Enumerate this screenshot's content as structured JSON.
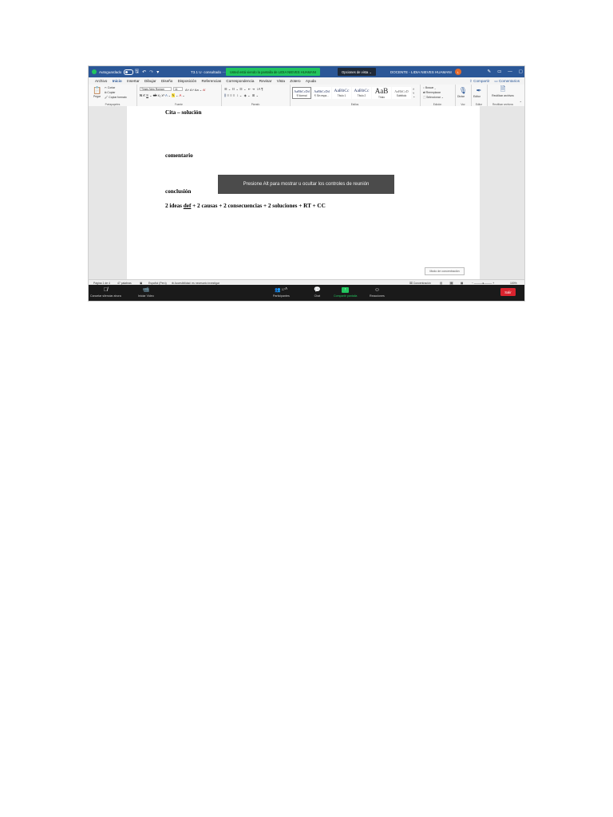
{
  "titlebar": {
    "autosave_label": "Autoguardado",
    "doc_title": "T3.1 U· consultado ···",
    "share_banner": "Usted está viendo la pantalla de LIDIA NIEVES HUAMANI",
    "view_options": "Opciones de vista ⌄",
    "account_name": "DOCENTE - LIDIA NIEVES HUAMANI",
    "account_initials": "L"
  },
  "menu": {
    "tabs": [
      "Archivo",
      "Inicio",
      "Insertar",
      "Dibujar",
      "Diseño",
      "Disposición",
      "Referencias",
      "Correspondencia",
      "Revisar",
      "Vista",
      "Zotero",
      "Ayuda"
    ],
    "active_tab": "Inicio",
    "share_label": "Compartir",
    "comments_label": "Comentarios"
  },
  "ribbon": {
    "clipboard": {
      "paste": "Pegar",
      "cut": "Cortar",
      "copy": "Copiar",
      "format_painter": "Copiar formato",
      "caption": "Portapapeles"
    },
    "font": {
      "name": "Times New Roman",
      "size": "11",
      "caption": "Fuente"
    },
    "paragraph": {
      "caption": "Párrafo"
    },
    "styles": {
      "items": [
        {
          "preview": "AaBbCcDd",
          "name": "¶ Normal"
        },
        {
          "preview": "AaBbCcDd",
          "name": "¶ Sin espa..."
        },
        {
          "preview": "AaBbCc",
          "name": "Título 1"
        },
        {
          "preview": "AaBbCc",
          "name": "Título 2"
        },
        {
          "preview": "AaB",
          "name": "Título"
        },
        {
          "preview": "AaBbCcD",
          "name": "Subtítulo"
        }
      ],
      "caption": "Estilos"
    },
    "editing": {
      "find": "Buscar",
      "replace": "Reemplazar",
      "select": "Seleccionar",
      "caption": "Edición"
    },
    "voice": {
      "dictate": "Dictar",
      "caption": "Voz"
    },
    "editor": {
      "label": "Editor",
      "caption": "Editor"
    },
    "sensitivity": {
      "label": "Reutilizar archivos",
      "caption": "Reutilizar archivos"
    }
  },
  "document": {
    "line1": "Cita – solución",
    "line2": "comentario",
    "line3": "conclusión",
    "line4_a": "2 ideas ",
    "line4_b": "def",
    "line4_c": " + 2 causas + 2 consecuencias + 2 soluciones + RT + CC"
  },
  "tooltip": "Presione Alt para mostrar u ocultar los controles de reunión",
  "conversation_mode": "Modo de concentración",
  "status": {
    "page": "Página 1 de 4",
    "words": "47 palabras",
    "language": "Español (Perú)",
    "accessibility": "Accesibilidad: es necesario investigar",
    "focus": "Concentración",
    "zoom": "100%"
  },
  "meeting": {
    "mute": "Cancelar silenciar ahora",
    "video": "Iniciar Video",
    "participants": "Participantes",
    "participants_count": "17",
    "chat": "Chat",
    "share": "Compartir pantalla",
    "reactions": "Reacciones",
    "leave": "Salir"
  },
  "colors": {
    "titlebar": "#2b5797",
    "share_banner": "#22c55e",
    "leave": "#d9232e",
    "meeting_bar": "#1a1a1a"
  }
}
